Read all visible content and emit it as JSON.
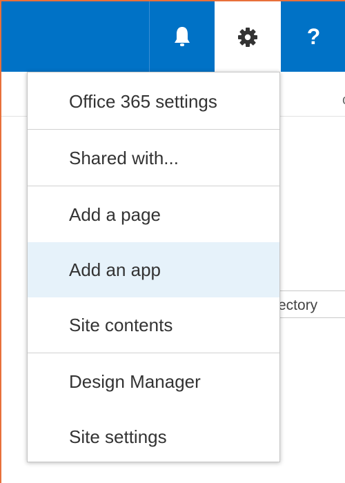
{
  "colors": {
    "suitebar": "#0072c6",
    "hover": "#e6f2fa",
    "frame_border": "#e8703a"
  },
  "suitebar": {
    "buttons": [
      {
        "name": "notifications",
        "icon": "bell-icon"
      },
      {
        "name": "settings",
        "icon": "gear-icon",
        "state": "open"
      },
      {
        "name": "help",
        "icon": "help-icon",
        "label": "?"
      }
    ]
  },
  "background": {
    "field_fragment": "ectory"
  },
  "settings_menu": {
    "hovered_item": "Add an app",
    "items": [
      {
        "label": "Office 365 settings"
      },
      {
        "label": "Shared with..."
      },
      {
        "label": "Add a page"
      },
      {
        "label": "Add an app"
      },
      {
        "label": "Site contents"
      },
      {
        "label": "Design Manager"
      },
      {
        "label": "Site settings"
      }
    ]
  }
}
